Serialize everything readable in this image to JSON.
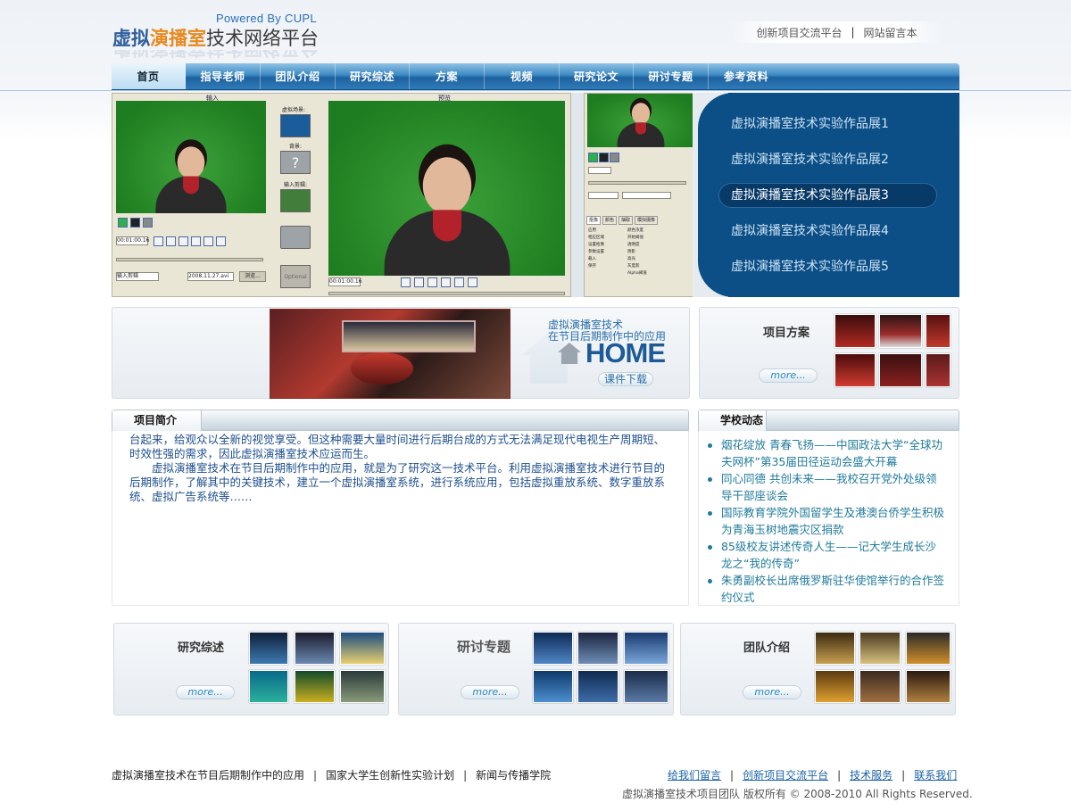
{
  "header": {
    "powered_by": "Powered By CUPL",
    "logo_part1": "虚拟",
    "logo_part2": "演播室",
    "logo_part3": "技术网络平台",
    "links": [
      "创新项目交流平台",
      "网站留言本"
    ],
    "link_separator": "|"
  },
  "nav": {
    "items": [
      {
        "label": "首页",
        "active": true
      },
      {
        "label": "指导老师",
        "active": false
      },
      {
        "label": "团队介绍",
        "active": false
      },
      {
        "label": "研究综述",
        "active": false
      },
      {
        "label": "方案",
        "active": false
      },
      {
        "label": "视频",
        "active": false
      },
      {
        "label": "研究论文",
        "active": false
      },
      {
        "label": "研讨专题",
        "active": false
      },
      {
        "label": "参考资料",
        "active": false
      }
    ]
  },
  "banner": {
    "software": {
      "input_label": "输入",
      "preview_label": "预览",
      "virtual_scene": "虚拟场景:",
      "background": "背景:",
      "input_clip": "输入剪辑:",
      "timecode_1": "00:01:00.16",
      "timecode_2": "00:01:00.16",
      "input_select": "输入剪辑",
      "file_name": "2008.11.27.avi",
      "browse_button": "浏览...",
      "optional_label": "Optional",
      "tabs": [
        "抠像",
        "颜色",
        "抽取",
        "模拟摄像"
      ],
      "right_options": [
        "应用",
        "相应区域",
        "设置抠像",
        "参数设置",
        "载入",
        "保存"
      ],
      "right_params": [
        "颜色浓度",
        "开始阈值",
        "透明度",
        "阴影",
        "高光",
        "灰度影",
        "Alpha阈值"
      ]
    },
    "gallery": [
      {
        "label": "虚拟演播室技术实验作品展1",
        "selected": false
      },
      {
        "label": "虚拟演播室技术实验作品展2",
        "selected": false
      },
      {
        "label": "虚拟演播室技术实验作品展3",
        "selected": true
      },
      {
        "label": "虚拟演播室技术实验作品展4",
        "selected": false
      },
      {
        "label": "虚拟演播室技术实验作品展5",
        "selected": false
      }
    ]
  },
  "promo": {
    "caption_line1": "虚拟演播室技术",
    "caption_line2": "在节目后期制作中的应用",
    "home_word": "HOME",
    "download_button": "课件下载"
  },
  "project_plan": {
    "title": "项目方案",
    "more": "more..."
  },
  "intro": {
    "title": "项目简介",
    "paragraphs": [
      "台起来，给观众以全新的视觉享受。但这种需要大量时间进行后期台成的方式无法满足现代电视生产周期短、时效性强的需求，因此虚拟演播室技术应运而生。",
      "　　虚拟演播室技术在节目后期制作中的应用，就是为了研究这一技术平台。利用虚拟演播室技术进行节目的后期制作，了解其中的关键技术，建立一个虚拟演播室系统，进行系统应用，包括虚拟重放系统、数字重放系统、虚拟广告系统等……"
    ]
  },
  "news": {
    "title": "学校动态",
    "items": [
      "烟花绽放 青春飞扬——中国政法大学“全球功夫网杯”第35届田径运动会盛大开幕",
      "同心同德 共创未来——我校召开党外处级领导干部座谈会",
      "国际教育学院外国留学生及港澳台侨学生积极为青海玉树地震灾区捐款",
      "85级校友讲述传奇人生——记大学生成长沙龙之“我的传奇”",
      "朱勇副校长出席俄罗斯驻华使馆举行的合作签约仪式"
    ]
  },
  "bottom_boxes": [
    {
      "title": "研究综述",
      "more": "more..."
    },
    {
      "title": "研讨专题",
      "more": "more..."
    },
    {
      "title": "团队介绍",
      "more": "more..."
    }
  ],
  "footer": {
    "left": [
      "虚拟演播室技术在节目后期制作中的应用",
      "国家大学生创新性实验计划",
      "新闻与传播学院"
    ],
    "right": [
      "给我们留言",
      "创新项目交流平台",
      "技术服务",
      "联系我们"
    ],
    "separator": "|",
    "copyright": "虚拟演播室技术项目团队 版权所有 © 2008-2010 All Rights Reserved."
  },
  "colors": {
    "nav_blue": "#1e62a0",
    "gallery_bg": "#0b4f86",
    "intro_text": "#1e4f8f",
    "news_text": "#1f7a9c",
    "footer_link": "#1b63a8"
  }
}
